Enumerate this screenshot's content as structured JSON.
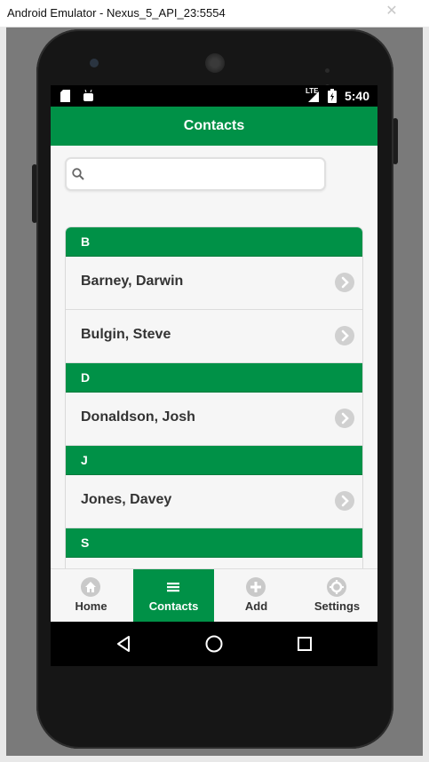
{
  "window": {
    "title": "Android Emulator - Nexus_5_API_23:5554",
    "close_label": "✕"
  },
  "status": {
    "time": "5:40",
    "network": "LTE"
  },
  "app": {
    "title": "Contacts",
    "search": {
      "placeholder": "",
      "value": ""
    },
    "groups": [
      {
        "letter": "B",
        "contacts": [
          "Barney, Darwin",
          "Bulgin, Steve"
        ]
      },
      {
        "letter": "D",
        "contacts": [
          "Donaldson, Josh"
        ]
      },
      {
        "letter": "J",
        "contacts": [
          "Jones, Davey"
        ]
      },
      {
        "letter": "S",
        "contacts": []
      }
    ]
  },
  "tabs": [
    {
      "label": "Home",
      "icon": "home-icon",
      "active": false
    },
    {
      "label": "Contacts",
      "icon": "list-icon",
      "active": true
    },
    {
      "label": "Add",
      "icon": "plus-icon",
      "active": false
    },
    {
      "label": "Settings",
      "icon": "gear-icon",
      "active": false
    }
  ],
  "colors": {
    "accent": "#009147",
    "surface": "#f6f6f6",
    "arrow_bg": "#d0d0d0"
  }
}
